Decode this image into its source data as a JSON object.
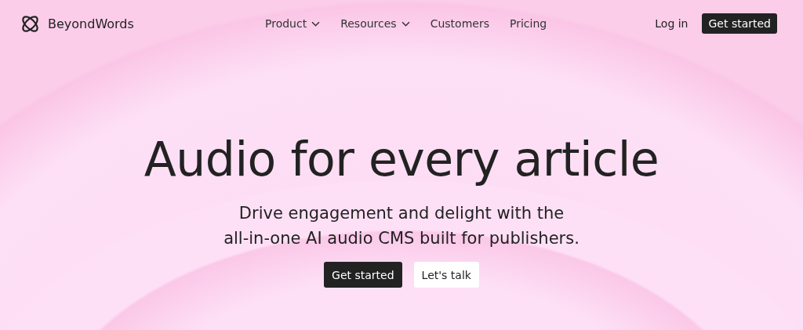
{
  "header": {
    "logo": {
      "text": "BeyondWords"
    },
    "nav": [
      {
        "label": "Product",
        "kind": "dropdown"
      },
      {
        "label": "Resources",
        "kind": "dropdown"
      },
      {
        "label": "Customers",
        "kind": "link"
      },
      {
        "label": "Pricing",
        "kind": "link"
      }
    ],
    "actions": [
      {
        "label": "Log in",
        "kind": "link"
      },
      {
        "label": "Get started",
        "kind": "primary"
      }
    ]
  },
  "hero": {
    "title": "Audio for every article",
    "subtitle_lines": [
      "Drive engagement and delight with the",
      "all-in-one AI audio CMS built for publishers."
    ],
    "buttons": [
      {
        "label": "Get started",
        "kind": "primary"
      },
      {
        "label": "Let's talk",
        "kind": "secondary"
      }
    ]
  }
}
